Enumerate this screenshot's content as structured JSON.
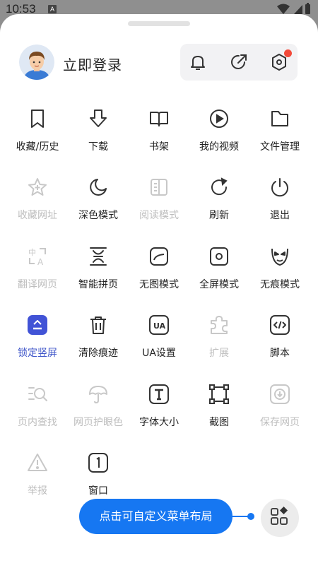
{
  "status": {
    "time": "10:53",
    "notification_icon": "A"
  },
  "account": {
    "login_label": "立即登录"
  },
  "top_actions": [
    {
      "name": "bell-icon"
    },
    {
      "name": "share-icon"
    },
    {
      "name": "settings-hex-icon",
      "badge": true
    }
  ],
  "menu": [
    {
      "label": "收藏/历史",
      "icon": "bookmark-icon",
      "state": "normal"
    },
    {
      "label": "下载",
      "icon": "download-icon",
      "state": "normal"
    },
    {
      "label": "书架",
      "icon": "book-icon",
      "state": "normal"
    },
    {
      "label": "我的视频",
      "icon": "play-icon",
      "state": "normal"
    },
    {
      "label": "文件管理",
      "icon": "folder-icon",
      "state": "normal"
    },
    {
      "label": "收藏网址",
      "icon": "star-add-icon",
      "state": "disabled"
    },
    {
      "label": "深色模式",
      "icon": "moon-icon",
      "state": "normal"
    },
    {
      "label": "阅读模式",
      "icon": "reader-icon",
      "state": "disabled"
    },
    {
      "label": "刷新",
      "icon": "refresh-icon",
      "state": "normal"
    },
    {
      "label": "退出",
      "icon": "power-icon",
      "state": "normal"
    },
    {
      "label": "翻译网页",
      "icon": "translate-icon",
      "state": "disabled"
    },
    {
      "label": "智能拼页",
      "icon": "merge-pages-icon",
      "state": "normal"
    },
    {
      "label": "无图模式",
      "icon": "no-image-icon",
      "state": "normal"
    },
    {
      "label": "全屏模式",
      "icon": "fullscreen-icon",
      "state": "normal"
    },
    {
      "label": "无痕模式",
      "icon": "incognito-icon",
      "state": "normal"
    },
    {
      "label": "锁定竖屏",
      "icon": "lock-portrait-icon",
      "state": "active"
    },
    {
      "label": "清除痕迹",
      "icon": "trash-icon",
      "state": "normal"
    },
    {
      "label": "UA设置",
      "icon": "ua-icon",
      "state": "normal"
    },
    {
      "label": "扩展",
      "icon": "puzzle-icon",
      "state": "disabled"
    },
    {
      "label": "脚本",
      "icon": "code-icon",
      "state": "normal"
    },
    {
      "label": "页内查找",
      "icon": "find-in-page-icon",
      "state": "disabled"
    },
    {
      "label": "网页护眼色",
      "icon": "umbrella-icon",
      "state": "disabled"
    },
    {
      "label": "字体大小",
      "icon": "font-size-icon",
      "state": "normal"
    },
    {
      "label": "截图",
      "icon": "screenshot-icon",
      "state": "normal"
    },
    {
      "label": "保存网页",
      "icon": "save-page-icon",
      "state": "disabled"
    },
    {
      "label": "举报",
      "icon": "report-icon",
      "state": "disabled"
    },
    {
      "label": "窗口",
      "icon": "window-icon",
      "state": "normal"
    }
  ],
  "footer": {
    "hint": "点击可自定义菜单布局"
  },
  "colors": {
    "accent": "#1677f2",
    "active": "#3f56c9",
    "disabled": "#bdbdbd",
    "badge": "#f34a3a"
  }
}
